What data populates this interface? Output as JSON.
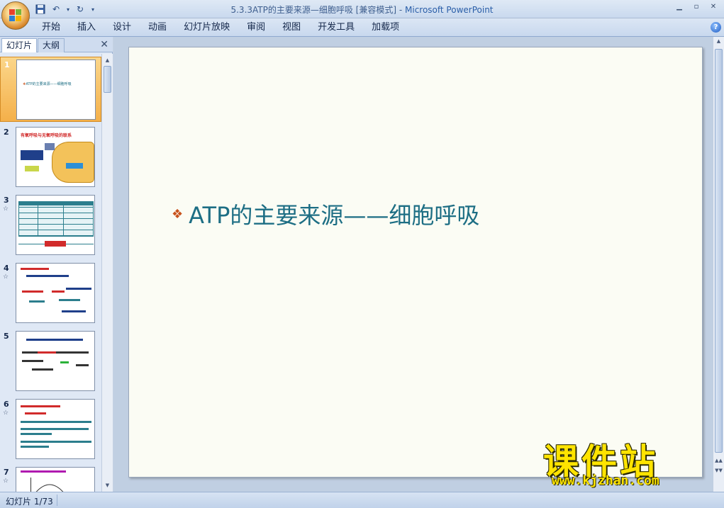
{
  "window": {
    "title_file": "5.3.3ATP的主要来源—细胞呼吸 [兼容模式] - ",
    "title_app": "Microsoft PowerPoint"
  },
  "quick_access": {
    "save_icon": "save-icon",
    "undo_icon": "undo-icon",
    "redo_icon": "redo-icon"
  },
  "ribbon": {
    "tabs": [
      "开始",
      "插入",
      "设计",
      "动画",
      "幻灯片放映",
      "审阅",
      "视图",
      "开发工具",
      "加载项"
    ],
    "help_label": "?"
  },
  "panel": {
    "tab_slides": "幻灯片",
    "tab_outline": "大纲",
    "close_label": "✕",
    "thumbnails": [
      {
        "num": "1",
        "selected": true,
        "has_animation": false,
        "text": "ATP的主要来源——细胞呼吸"
      },
      {
        "num": "2",
        "selected": false,
        "has_animation": false,
        "text": "有氧呼吸与无氧呼吸的联系"
      },
      {
        "num": "3",
        "selected": false,
        "has_animation": true,
        "text": ""
      },
      {
        "num": "4",
        "selected": false,
        "has_animation": true,
        "text": ""
      },
      {
        "num": "5",
        "selected": false,
        "has_animation": false,
        "text": ""
      },
      {
        "num": "6",
        "selected": false,
        "has_animation": true,
        "text": ""
      },
      {
        "num": "7",
        "selected": false,
        "has_animation": true,
        "text": ""
      }
    ]
  },
  "slide": {
    "bullet": "❖",
    "title": "ATP的主要来源——细胞呼吸"
  },
  "status": {
    "slide_indicator": "幻灯片 1/73"
  },
  "watermark": {
    "main": "课件站",
    "url": "www.kjzhan.com"
  },
  "colors": {
    "slide_text": "#1d6e84",
    "bullet": "#c8521c",
    "selected_thumb": "#f4b04a"
  }
}
